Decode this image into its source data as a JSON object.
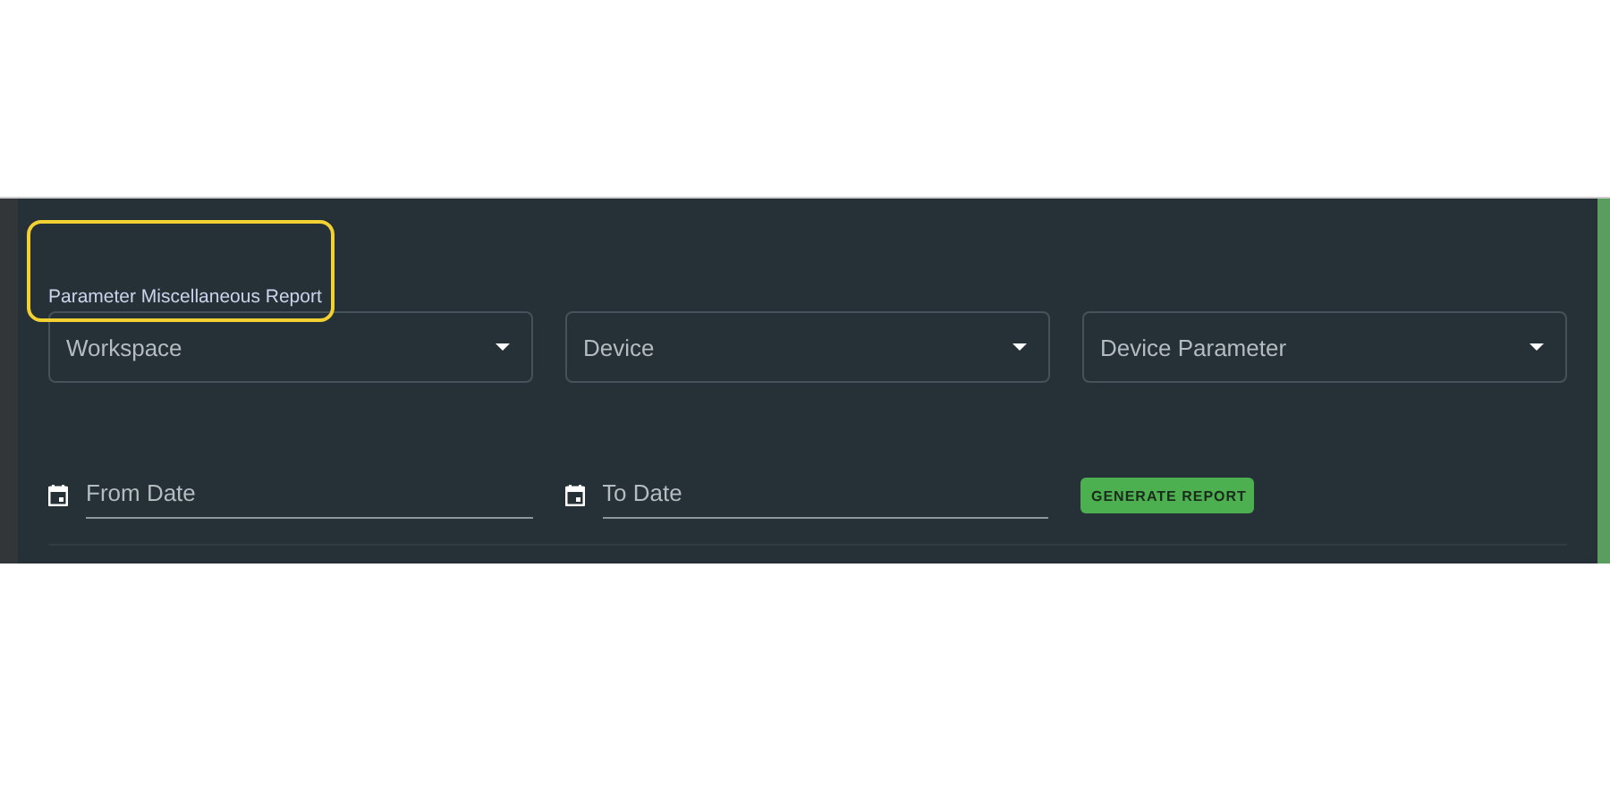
{
  "report": {
    "title": "Parameter Miscellaneous Report",
    "selects": [
      {
        "placeholder": "Workspace"
      },
      {
        "placeholder": "Device"
      },
      {
        "placeholder": "Device Parameter"
      }
    ],
    "date_fields": [
      {
        "placeholder": "From Date"
      },
      {
        "placeholder": "To Date"
      }
    ],
    "button": "GENERATE REPORT"
  }
}
